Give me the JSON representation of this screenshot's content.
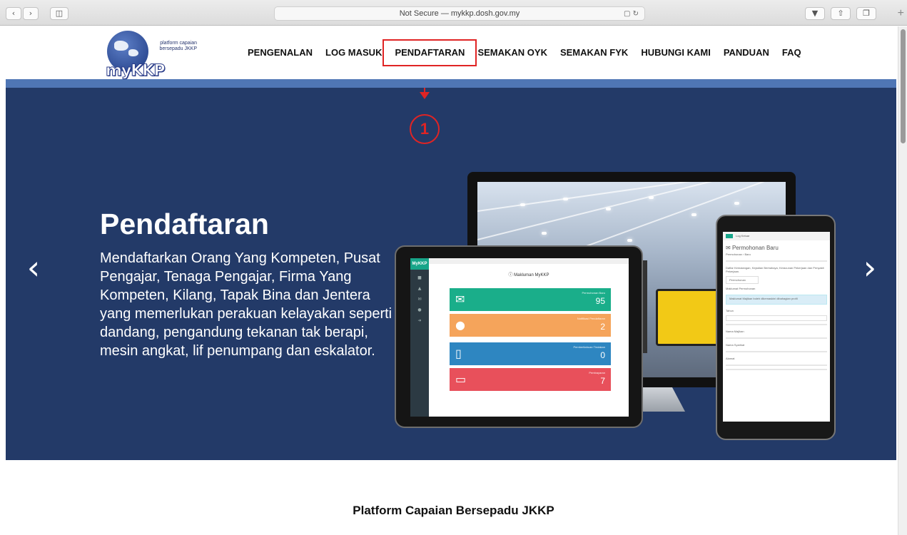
{
  "browser": {
    "back_icon": "chevron-left-icon",
    "forward_icon": "chevron-right-icon",
    "sidebar_icon": "sidebar-icon",
    "url": "Not Secure — mykkp.dosh.gov.my",
    "reader_icon": "reader-icon",
    "reload_icon": "reload-icon",
    "download_icon": "download-icon",
    "share_icon": "share-icon",
    "tabs_icon": "tabs-icon",
    "newtab_icon": "plus-icon"
  },
  "logo": {
    "line1": "platform capaian",
    "line2": "bersepadu JKKP",
    "wordmark": "myKKP"
  },
  "nav": {
    "items": [
      "PENGENALAN",
      "LOG MASUK",
      "PENDAFTARAN",
      "SEMAKAN OYK",
      "SEMAKAN FYK",
      "HUBUNGI KAMI",
      "PANDUAN",
      "FAQ"
    ],
    "active": "PENDAFTARAN"
  },
  "annotation": {
    "number": "1",
    "color": "#e02424"
  },
  "hero": {
    "title": "Pendaftaran",
    "text": "Mendaftarkan Orang Yang Kompeten, Pusat Pengajar, Tenaga Pengajar, Firma Yang Kompeten, Kilang, Tapak Bina dan Jentera yang memerlukan perakuan kelayakan seperti dandang, pengandung tekanan tak berapi, mesin angkat, lif penumpang dan eskalator.",
    "prev_icon": "chevron-left-icon",
    "next_icon": "chevron-right-icon",
    "background": "#233a68"
  },
  "tablet": {
    "brand": "MyKKP",
    "title": "Makluman MyKKP",
    "cards": [
      {
        "label": "Permohonan Baru",
        "value": "95",
        "color": "#1aae8a",
        "icon": "envelope-icon"
      },
      {
        "label": "Notifikasi Pendaftaran",
        "value": "2",
        "color": "#f5a45b",
        "icon": "user-icon"
      },
      {
        "label": "Pemberitahuan Tindakan",
        "value": "0",
        "color": "#2e86c1",
        "icon": "document-icon"
      },
      {
        "label": "Pembayaran",
        "value": "7",
        "color": "#e8505b",
        "icon": "money-icon"
      }
    ]
  },
  "phone": {
    "topbar": "Log Keluar",
    "title": "Permohonan Baru",
    "breadcrumb": "Permohonan › Baru",
    "desc": "Daftar Kemalangan, Kejadian Berbahaya, Keracunan Pekerjaan dan Penyakit Pekerjaan.",
    "tab": "Permohonan",
    "section": "Maklumat Permohonan",
    "notice": "Maklumat Majikan boleh dikemaskini dibahagian profil",
    "fields": [
      "Tahun",
      "Nama Majikan",
      "Nama Syarikat",
      "Alamat"
    ]
  },
  "section": {
    "title": "Platform Capaian Bersepadu JKKP"
  }
}
